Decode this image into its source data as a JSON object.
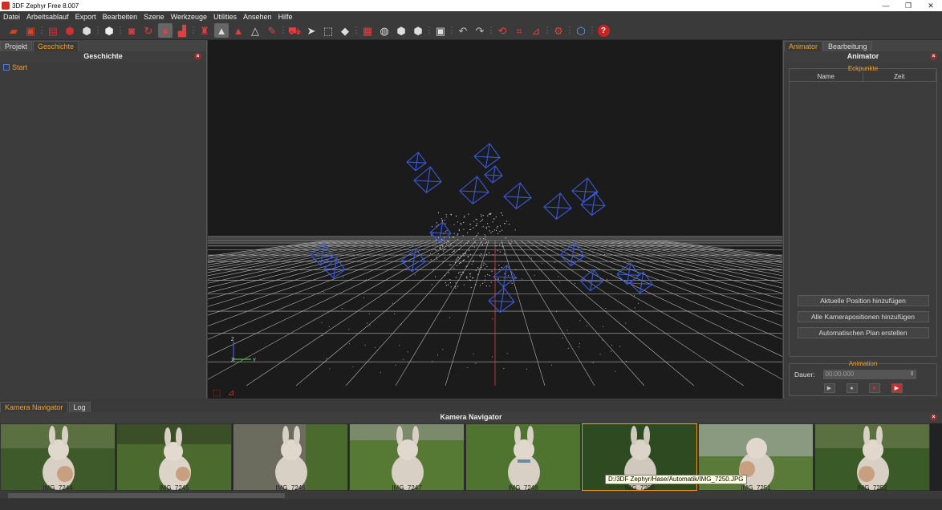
{
  "window": {
    "title": "3DF Zephyr Free 8.007",
    "minimize": "—",
    "maximize": "❐",
    "close": "✕"
  },
  "menu": [
    "Datei",
    "Arbeitsablauf",
    "Export",
    "Bearbeiten",
    "Szene",
    "Werkzeuge",
    "Utilities",
    "Ansehen",
    "Hilfe"
  ],
  "toolbar_icons": [
    "open-icon",
    "save-icon",
    "pipeline-icon",
    "dense-cloud-icon",
    "mesh-icon",
    "textured-mesh-icon",
    "screenshot-icon",
    "rotate-icon",
    "point-icon",
    "split-icon",
    "camera-icon",
    "mesh-tri-icon",
    "mesh-tri-red-icon",
    "mesh-wire-icon",
    "brush-icon",
    "bbox-icon",
    "pointer-icon",
    "select-icon",
    "transform-icon",
    "grid-icon",
    "sphere-grid-icon",
    "cube-icon",
    "cube2-icon",
    "image-icon",
    "undo-icon",
    "redo-icon",
    "orbit-icon",
    "crop-icon",
    "measure-icon",
    "settings-icon",
    "viewcube-icon",
    "help-icon"
  ],
  "left_panel": {
    "tabs": [
      "Projekt",
      "Geschichte"
    ],
    "header": "Geschichte",
    "close": "×",
    "history": [
      {
        "label": "Start"
      }
    ]
  },
  "viewport": {
    "axis_z": "Z",
    "axis_x": "X",
    "axis_y": "Y"
  },
  "right_panel": {
    "tabs": [
      "Animator",
      "Bearbeitung"
    ],
    "header": "Animator",
    "close": "×",
    "keyframes_title": "Eckpunkte",
    "columns": [
      "Name",
      "Zeit"
    ],
    "buttons": [
      "Aktuelle Position hinzufügen",
      "Alle Kamerapositionen hinzufügen",
      "Automatischen Plan erstellen"
    ],
    "animation_title": "Animation",
    "duration_label": "Dauer:",
    "duration_value": "00:00.000"
  },
  "bottom_panel": {
    "tabs": [
      "Kamera Navigator",
      "Log"
    ],
    "header": "Kamera Navigator",
    "close": "×",
    "thumbnails": [
      {
        "label": "IMG_7244"
      },
      {
        "label": "IMG_7245"
      },
      {
        "label": "IMG_7246"
      },
      {
        "label": "IMG_7247"
      },
      {
        "label": "IMG_7248"
      },
      {
        "label": "IMG_7250"
      },
      {
        "label": "IMG_7251"
      },
      {
        "label": "IMG_7252"
      }
    ],
    "tooltip": "D:/3DF Zephyr/Hase/Automatik/IMG_7250.JPG"
  },
  "colors": {
    "accent": "#f0a020",
    "camera_frustum": "#3a5ae0",
    "close_red": "#8a3030"
  }
}
